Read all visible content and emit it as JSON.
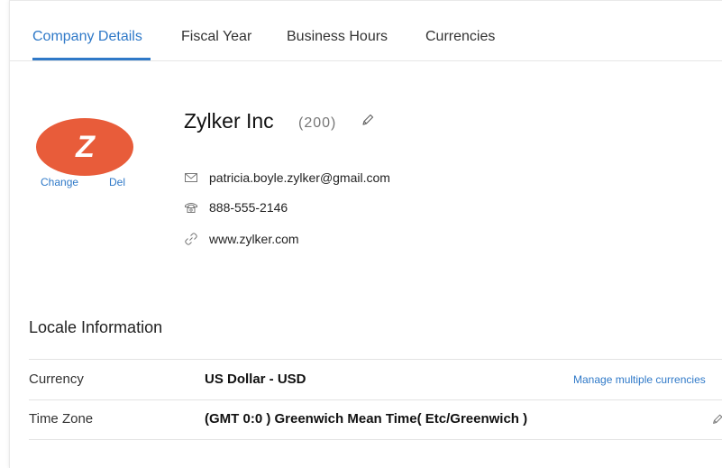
{
  "tabs": [
    {
      "label": "Company Details",
      "active": true
    },
    {
      "label": "Fiscal Year",
      "active": false
    },
    {
      "label": "Business Hours",
      "active": false
    },
    {
      "label": "Currencies",
      "active": false
    }
  ],
  "logo": {
    "letter": "Z",
    "change_label": "Change",
    "delete_label": "Del"
  },
  "company": {
    "name": "Zylker Inc",
    "count": "(200)",
    "email": "patricia.boyle.zylker@gmail.com",
    "phone": "888-555-2146",
    "website": "www.zylker.com"
  },
  "locale": {
    "title": "Locale Information",
    "rows": [
      {
        "label": "Currency",
        "value": "US Dollar - USD",
        "action": "Manage multiple currencies"
      },
      {
        "label": "Time Zone",
        "value": "(GMT 0:0 ) Greenwich Mean Time( Etc/Greenwich )"
      }
    ]
  },
  "colors": {
    "accent": "#2f79c8",
    "logo_bg": "#e85c3a"
  },
  "icons": {
    "edit": "pencil-icon",
    "email": "envelope-icon",
    "phone": "telephone-icon",
    "website": "link-icon"
  }
}
